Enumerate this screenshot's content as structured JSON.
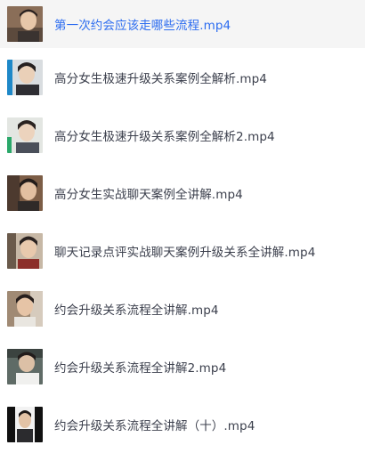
{
  "files": [
    {
      "name": "第一次约会应该走哪些流程.mp4",
      "thumb": "video-thumbnail-icon",
      "selected": true
    },
    {
      "name": "高分女生极速升级关系案例全解析.mp4",
      "thumb": "video-thumbnail-icon",
      "selected": false
    },
    {
      "name": "高分女生极速升级关系案例全解析2.mp4",
      "thumb": "video-thumbnail-icon",
      "selected": false
    },
    {
      "name": "高分女生实战聊天案例全讲解.mp4",
      "thumb": "video-thumbnail-icon",
      "selected": false
    },
    {
      "name": "聊天记录点评实战聊天案例升级关系全讲解.mp4",
      "thumb": "video-thumbnail-icon",
      "selected": false
    },
    {
      "name": "约会升级关系流程全讲解.mp4",
      "thumb": "video-thumbnail-icon",
      "selected": false
    },
    {
      "name": "约会升级关系流程全讲解2.mp4",
      "thumb": "video-thumbnail-icon",
      "selected": false
    },
    {
      "name": "约会升级关系流程全讲解（十）.mp4",
      "thumb": "video-thumbnail-icon",
      "selected": false
    }
  ],
  "colors": {
    "selected_text": "#2c6cf0",
    "text": "#3b3f4c",
    "selected_bg": "#f5f5f5"
  }
}
